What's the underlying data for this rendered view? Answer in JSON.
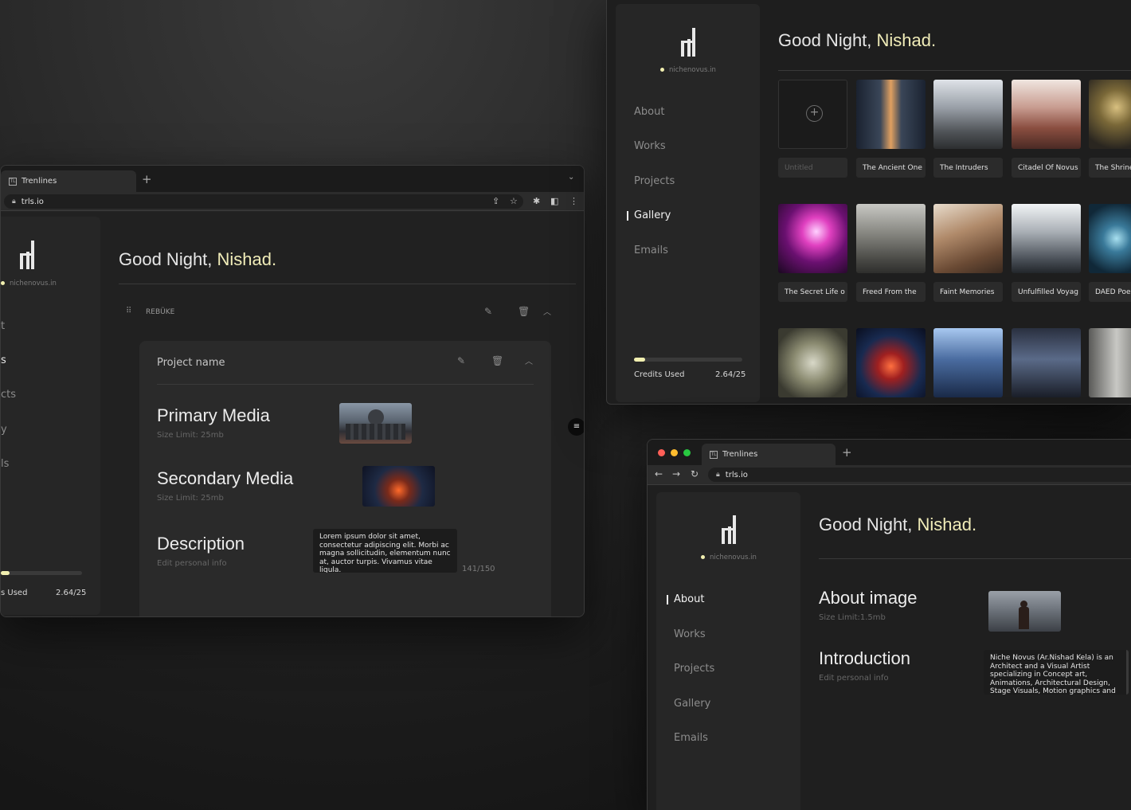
{
  "greeting": {
    "prefix": "Good Night, ",
    "name": "Nishad."
  },
  "site": "nichenovus.in",
  "nav": [
    "About",
    "Works",
    "Projects",
    "Gallery",
    "Emails"
  ],
  "credits": {
    "label": "Credits Used",
    "value": "2.64/25",
    "fraction": 0.1056
  },
  "colors": {
    "accent": "#f1efb0",
    "bg": "#1e1e1e"
  },
  "browser": {
    "tab_title": "Trenlines",
    "url": "trls.io",
    "favicon": "TL"
  },
  "winA": {
    "nav_fragments": [
      "t",
      "s",
      "cts",
      "y",
      "ls"
    ],
    "credits_fragment": "s Used",
    "section": "REBÜKE",
    "project_name": "Project name",
    "fields": {
      "primary": {
        "title": "Primary Media",
        "sub": "Size Limit: 25mb"
      },
      "secondary": {
        "title": "Secondary Media",
        "sub": "Size Limit: 25mb"
      },
      "description": {
        "title": "Description",
        "sub": "Edit personal info",
        "text": "Lorem ipsum dolor sit amet, consectetur adipiscing elit. Morbi ac magna sollicitudin, elementum nunc at, auctor turpis. Vivamus vitae ligula.",
        "count": "141/150"
      }
    }
  },
  "gallery": {
    "add_label": "Untitled",
    "items": [
      "The Ancient One",
      "The Intruders",
      "Citadel Of Novus",
      "The Shrine",
      "The Secret Life o",
      "Freed From the",
      "Faint Memories",
      "Unfulfilled Voyag",
      "DAED Poe"
    ]
  },
  "winC": {
    "active_nav": "About",
    "about_image": {
      "title": "About image",
      "sub": "Size Limit:1.5mb"
    },
    "intro": {
      "title": "Introduction",
      "sub": "Edit personal info",
      "text": "Niche Novus (Ar.Nishad Kela) is an Architect and a Visual Artist specializing in Concept art, Animations, Architectural Design, Stage Visuals, Motion graphics and"
    }
  }
}
